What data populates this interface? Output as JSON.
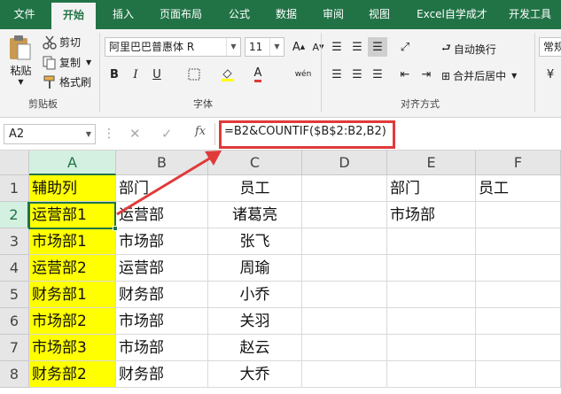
{
  "menu": {
    "tabs": [
      "文件",
      "开始",
      "插入",
      "页面布局",
      "公式",
      "数据",
      "审阅",
      "视图",
      "Excel自学成才",
      "开发工具"
    ],
    "active": "开始"
  },
  "ribbon": {
    "clipboard": {
      "paste": "粘贴",
      "cut": "剪切",
      "copy": "复制",
      "format_painter": "格式刷",
      "group": "剪贴板"
    },
    "font": {
      "name": "阿里巴巴普惠体 R",
      "size": "11",
      "group": "字体",
      "bold": "B",
      "italic": "I",
      "underline": "U",
      "phonetic": "wén"
    },
    "alignment": {
      "wrap": "自动换行",
      "merge": "合并后居中",
      "group": "对齐方式"
    },
    "number": {
      "format": "常规"
    }
  },
  "formula_bar": {
    "name_box": "A2",
    "fx": "fx",
    "formula": "=B2&COUNTIF($B$2:B2,B2)"
  },
  "grid": {
    "columns": [
      "A",
      "B",
      "C",
      "D",
      "E",
      "F"
    ],
    "selected_column": "A",
    "selected_row": "2",
    "rows": [
      {
        "num": "1",
        "A": "辅助列",
        "B": "部门",
        "C": "员工",
        "D": "",
        "E": "部门",
        "F": "员工"
      },
      {
        "num": "2",
        "A": "运营部1",
        "B": "运营部",
        "C": "诸葛亮",
        "D": "",
        "E": "市场部",
        "F": ""
      },
      {
        "num": "3",
        "A": "市场部1",
        "B": "市场部",
        "C": "张飞",
        "D": "",
        "E": "",
        "F": ""
      },
      {
        "num": "4",
        "A": "运营部2",
        "B": "运营部",
        "C": "周瑜",
        "D": "",
        "E": "",
        "F": ""
      },
      {
        "num": "5",
        "A": "财务部1",
        "B": "财务部",
        "C": "小乔",
        "D": "",
        "E": "",
        "F": ""
      },
      {
        "num": "6",
        "A": "市场部2",
        "B": "市场部",
        "C": "关羽",
        "D": "",
        "E": "",
        "F": ""
      },
      {
        "num": "7",
        "A": "市场部3",
        "B": "市场部",
        "C": "赵云",
        "D": "",
        "E": "",
        "F": ""
      },
      {
        "num": "8",
        "A": "财务部2",
        "B": "财务部",
        "C": "大乔",
        "D": "",
        "E": "",
        "F": ""
      }
    ]
  },
  "colors": {
    "excel_green": "#217346",
    "highlight_yellow": "#ffff00",
    "annotation_red": "#e03a3a"
  }
}
